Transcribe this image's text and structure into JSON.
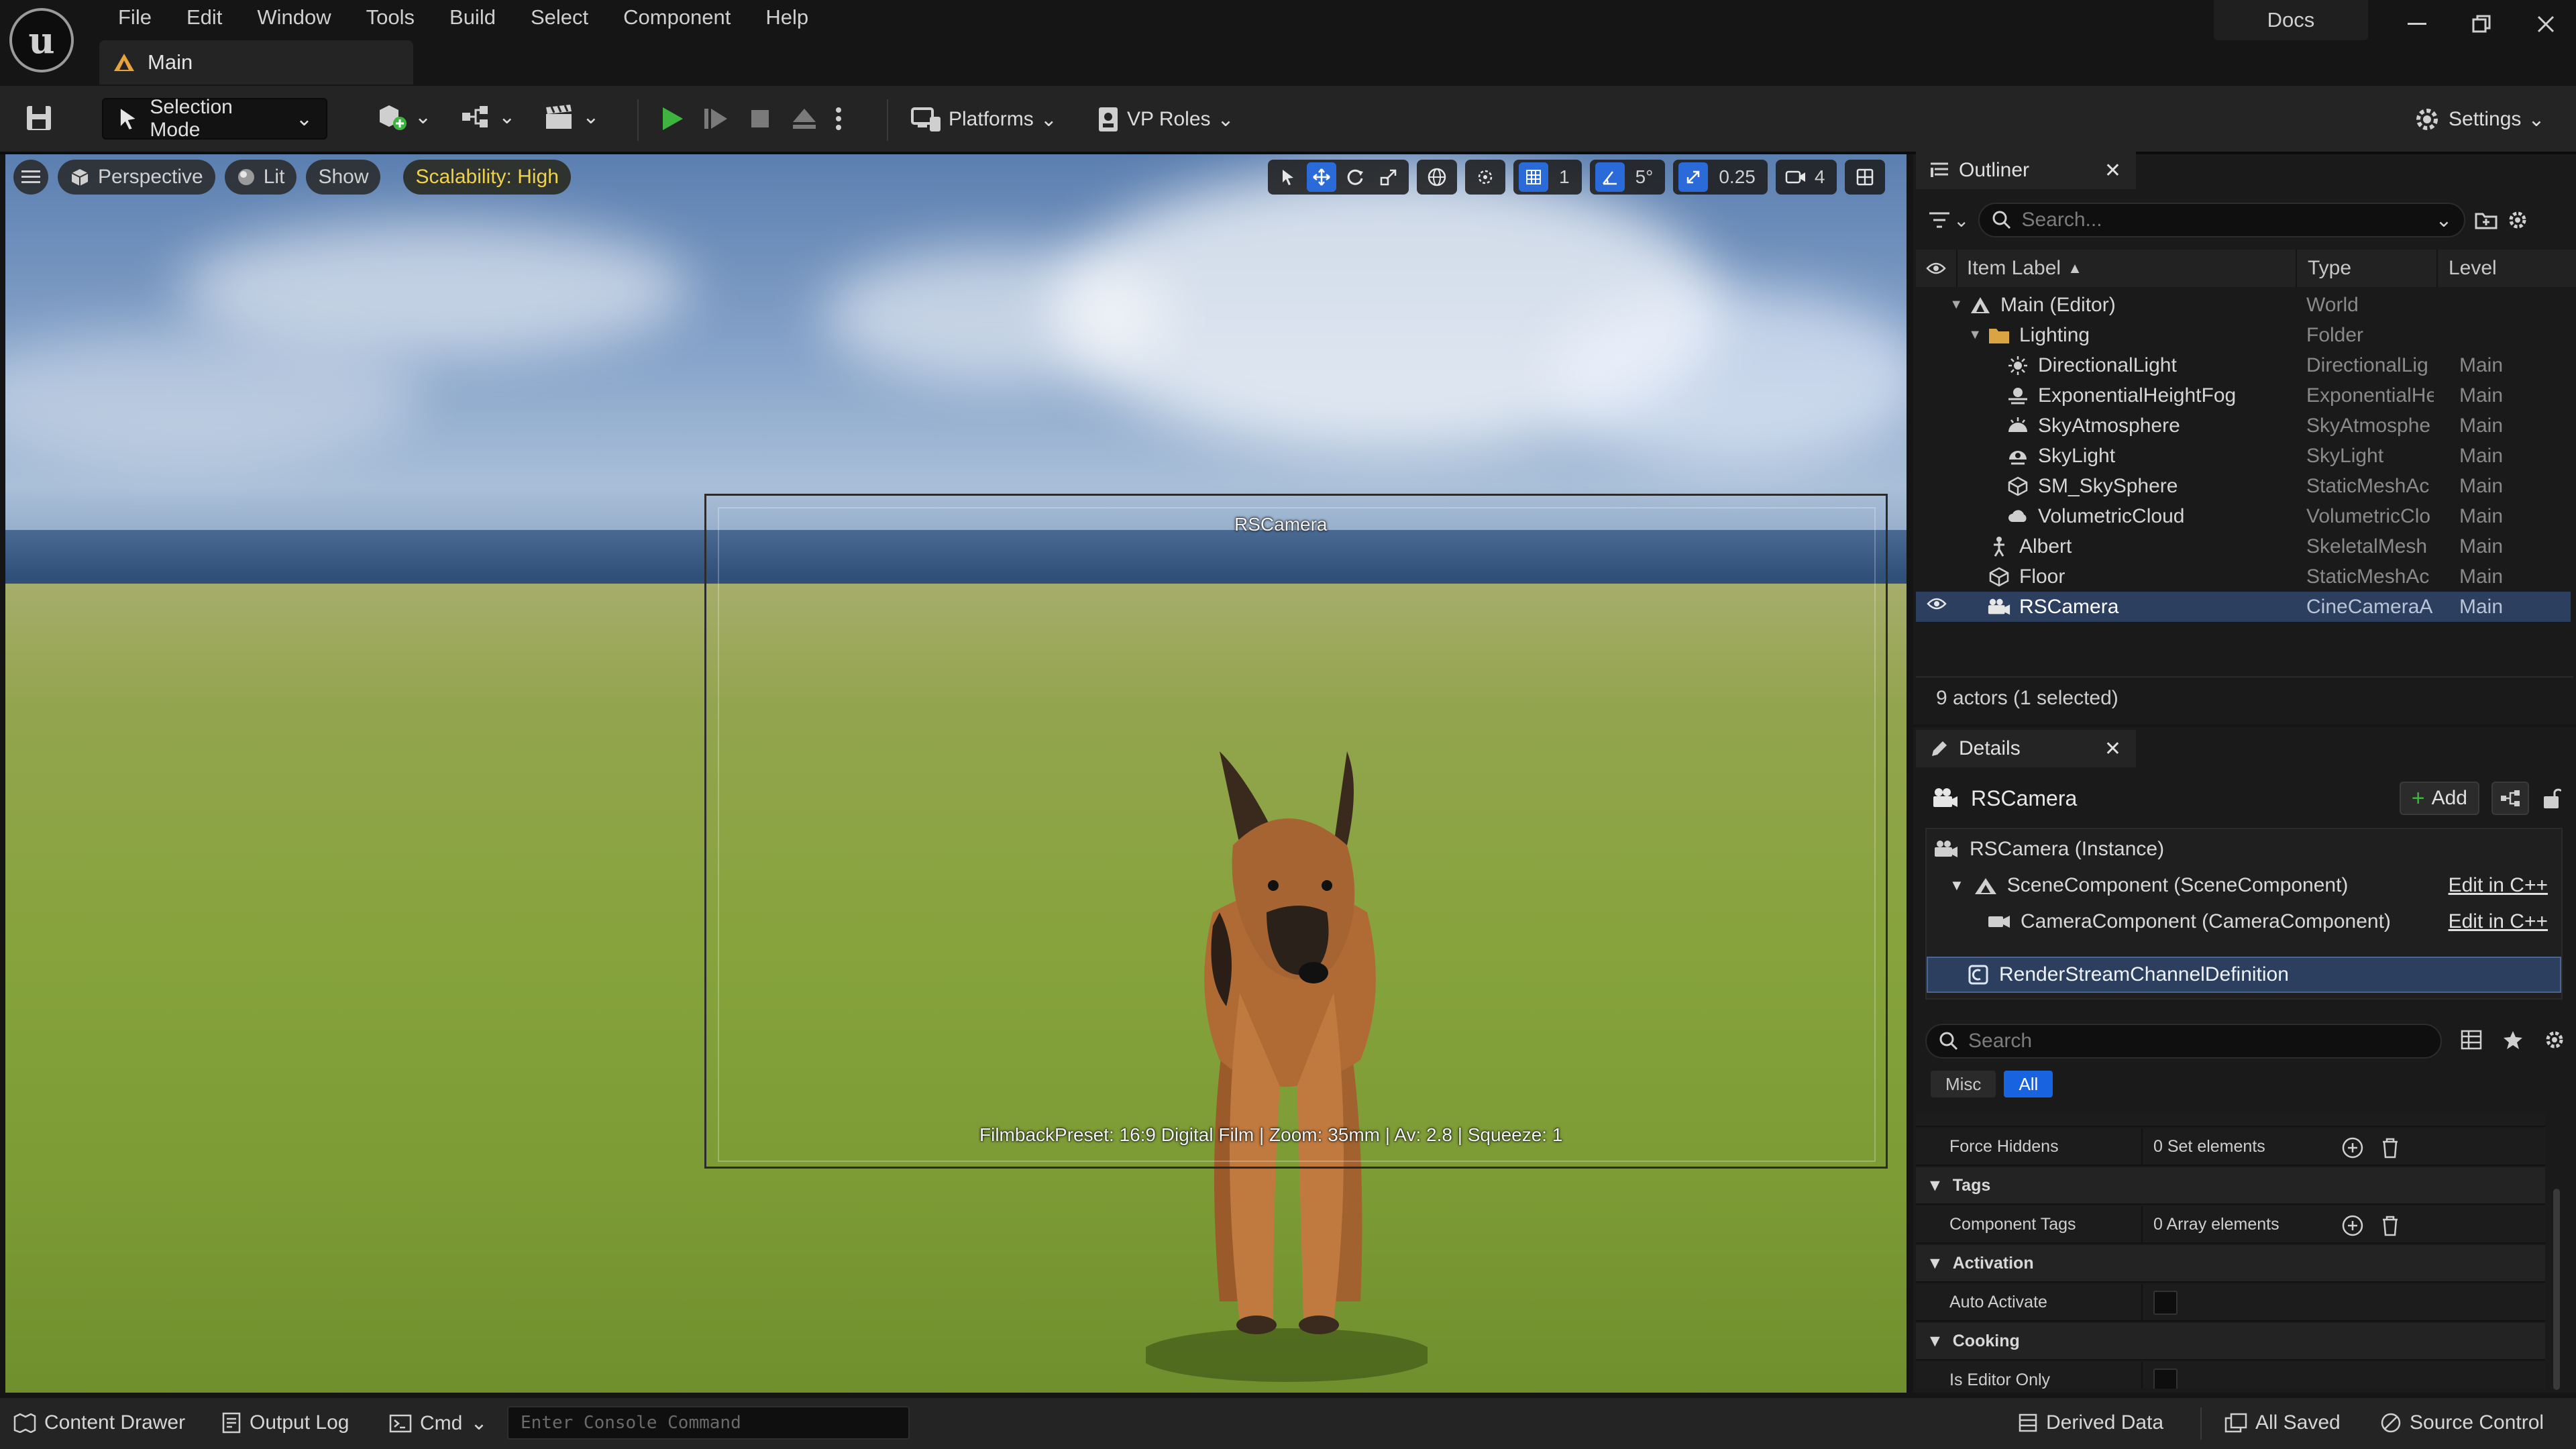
{
  "app": {
    "menu": [
      "File",
      "Edit",
      "Window",
      "Tools",
      "Build",
      "Select",
      "Component",
      "Help"
    ],
    "tab_title": "Main",
    "docs_label": "Docs"
  },
  "toolbar": {
    "selection_mode": "Selection Mode",
    "platforms": "Platforms",
    "vp_roles": "VP Roles",
    "settings": "Settings"
  },
  "viewport": {
    "perspective": "Perspective",
    "lit": "Lit",
    "show": "Show",
    "scalability": "Scalability: High",
    "grid_snap": "1",
    "rotation_snap": "5°",
    "scale_snap": "0.25",
    "camera_speed": "4",
    "camera_name": "RSCamera",
    "camera_info": "FilmbackPreset: 16:9 Digital Film | Zoom: 35mm | Av: 2.8 | Squeeze: 1"
  },
  "outliner": {
    "tab": "Outliner",
    "search_placeholder": "Search...",
    "columns": {
      "label": "Item Label",
      "type": "Type",
      "level": "Level"
    },
    "rows": [
      {
        "label": "Main (Editor)",
        "type": "World",
        "level": "",
        "icon": "world-icon",
        "indent": 1,
        "expander": true
      },
      {
        "label": "Lighting",
        "type": "Folder",
        "level": "",
        "icon": "folder-icon",
        "indent": 2,
        "expander": true
      },
      {
        "label": "DirectionalLight",
        "type": "DirectionalLig",
        "level": "Main",
        "icon": "directional-light-icon",
        "indent": 3
      },
      {
        "label": "ExponentialHeightFog",
        "type": "ExponentialHe",
        "level": "Main",
        "icon": "fog-icon",
        "indent": 3
      },
      {
        "label": "SkyAtmosphere",
        "type": "SkyAtmosphe",
        "level": "Main",
        "icon": "sky-atmosphere-icon",
        "indent": 3
      },
      {
        "label": "SkyLight",
        "type": "SkyLight",
        "level": "Main",
        "icon": "sky-light-icon",
        "indent": 3
      },
      {
        "label": "SM_SkySphere",
        "type": "StaticMeshAc",
        "level": "Main",
        "icon": "static-mesh-icon",
        "indent": 3
      },
      {
        "label": "VolumetricCloud",
        "type": "VolumetricClo",
        "level": "Main",
        "icon": "cloud-icon",
        "indent": 3
      },
      {
        "label": "Albert",
        "type": "SkeletalMesh",
        "level": "Main",
        "icon": "skeletal-mesh-icon",
        "indent": 2
      },
      {
        "label": "Floor",
        "type": "StaticMeshAc",
        "level": "Main",
        "icon": "static-mesh-icon",
        "indent": 2
      },
      {
        "label": "RSCamera",
        "type": "CineCameraA",
        "level": "Main",
        "icon": "camera-actor-icon",
        "indent": 2,
        "selected": true
      }
    ],
    "footer": "9 actors (1 selected)"
  },
  "details": {
    "tab": "Details",
    "actor_name": "RSCamera",
    "add_label": "Add",
    "components": [
      {
        "label": "RSCamera (Instance)",
        "edit": ""
      },
      {
        "label": "SceneComponent (SceneComponent)",
        "edit": "Edit in C++"
      },
      {
        "label": "CameraComponent (CameraComponent)",
        "edit": "Edit in C++"
      },
      {
        "label": "RenderStreamChannelDefinition",
        "edit": ""
      }
    ],
    "search_placeholder": "Search",
    "filters": [
      "Misc",
      "All"
    ],
    "properties": {
      "force_hiddens": {
        "name": "Force Hiddens",
        "value": "0 Set elements"
      },
      "tags_cat": "Tags",
      "component_tags": {
        "name": "Component Tags",
        "value": "0 Array elements"
      },
      "activation_cat": "Activation",
      "auto_activate": {
        "name": "Auto Activate"
      },
      "cooking_cat": "Cooking",
      "is_editor_only": {
        "name": "Is Editor Only"
      }
    }
  },
  "statusbar": {
    "content_drawer": "Content Drawer",
    "output_log": "Output Log",
    "cmd": "Cmd",
    "console_placeholder": "Enter Console Command",
    "derived_data": "Derived Data",
    "all_saved": "All Saved",
    "source_control": "Source Control"
  },
  "colors": {
    "accent_blue": "#1763e0",
    "selection": "#2c3f5e",
    "play_green": "#3fb33f",
    "scalability_yellow": "#f0d24a"
  }
}
